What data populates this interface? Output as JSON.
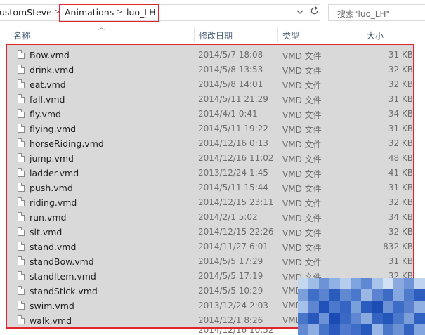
{
  "address": {
    "crumbs": [
      "ustomSteve",
      "Animations",
      "luo_LH"
    ],
    "separator": ">",
    "dropdown_icon": "chevron-down-icon",
    "refresh_icon": "refresh-icon"
  },
  "search": {
    "placeholder": "搜索\"luo_LH\""
  },
  "columns": {
    "name": "名称",
    "date": "修改日期",
    "type": "类型",
    "size": "大小"
  },
  "files": [
    {
      "name": "Bow.vmd",
      "date": "2014/5/7 18:08",
      "type": "VMD 文件",
      "size": "31 KB"
    },
    {
      "name": "drink.vmd",
      "date": "2014/5/8 13:53",
      "type": "VMD 文件",
      "size": "32 KB"
    },
    {
      "name": "eat.vmd",
      "date": "2014/5/8 14:01",
      "type": "VMD 文件",
      "size": "32 KB"
    },
    {
      "name": "fall.vmd",
      "date": "2014/5/11 21:29",
      "type": "VMD 文件",
      "size": "31 KB"
    },
    {
      "name": "fly.vmd",
      "date": "2014/4/1 0:41",
      "type": "VMD 文件",
      "size": "34 KB"
    },
    {
      "name": "flying.vmd",
      "date": "2014/5/11 19:22",
      "type": "VMD 文件",
      "size": "31 KB"
    },
    {
      "name": "horseRiding.vmd",
      "date": "2014/12/16 0:13",
      "type": "VMD 文件",
      "size": "32 KB"
    },
    {
      "name": "jump.vmd",
      "date": "2014/12/16 11:02",
      "type": "VMD 文件",
      "size": "48 KB"
    },
    {
      "name": "ladder.vmd",
      "date": "2013/12/24 1:45",
      "type": "VMD 文件",
      "size": "41 KB"
    },
    {
      "name": "push.vmd",
      "date": "2014/5/11 15:44",
      "type": "VMD 文件",
      "size": "31 KB"
    },
    {
      "name": "riding.vmd",
      "date": "2014/12/15 23:11",
      "type": "VMD 文件",
      "size": "32 KB"
    },
    {
      "name": "run.vmd",
      "date": "2014/2/1 5:02",
      "type": "VMD 文件",
      "size": "34 KB"
    },
    {
      "name": "sit.vmd",
      "date": "2014/12/15 22:26",
      "type": "VMD 文件",
      "size": "32 KB"
    },
    {
      "name": "stand.vmd",
      "date": "2014/11/27 6:01",
      "type": "VMD 文件",
      "size": "832 KB"
    },
    {
      "name": "standBow.vmd",
      "date": "2014/5/5 17:29",
      "type": "VMD 文件",
      "size": "31 KB"
    },
    {
      "name": "standItem.vmd",
      "date": "2014/5/5 17:19",
      "type": "VMD 文件",
      "size": "32 KB"
    },
    {
      "name": "standStick.vmd",
      "date": "2014/5/5 10:29",
      "type": "VMD",
      "size": ""
    },
    {
      "name": "swim.vmd",
      "date": "2013/12/24 2:03",
      "type": "VMD",
      "size": ""
    },
    {
      "name": "walk.vmd",
      "date": "2014/12/1 8:26",
      "type": "VMD",
      "size": ""
    }
  ],
  "partial_row": {
    "name": "",
    "date": "2014/12/16 10:52"
  },
  "colors": {
    "highlight": "#e0262b",
    "selection": "#d9d9d9",
    "header_text": "#4c607a"
  },
  "mosaic_colors": [
    "#c5d8f0",
    "#9fbce6",
    "#6d93d6",
    "#8fb1e3",
    "#b7cdee",
    "#7fa3dc",
    "#5f88d2",
    "#a9c4eb",
    "#d2e0f4",
    "#8ba9df",
    "#6e94d7",
    "#c0d4ef",
    "#7b9fda",
    "#3f6fc7",
    "#5a83d0",
    "#2a5cbe",
    "#6189d2",
    "#4a78cc",
    "#9bb8e5",
    "#5b83cf",
    "#3c6bc6",
    "#85a7e0",
    "#4e7bcc",
    "#2d5dbf",
    "#a5c1ea",
    "#5d85d0",
    "#1f51b8",
    "#4c79cb",
    "#3564c2",
    "#7aa0db",
    "#2b5bbd",
    "#1c4db5",
    "#6a90d5",
    "#3d6cc6",
    "#5880cf",
    "#90b0e3",
    "#4877ca",
    "#2858bc",
    "#6d93d6",
    "#1a4bb4",
    "#3a69c5",
    "#5f87d1",
    "#8aabe0",
    "#3563c2",
    "#2455bb",
    "#4b78cb",
    "#7c9fda",
    "#3060c0",
    "#6389d3",
    "#8eaee2",
    "#4574c9",
    "#2a5abd",
    "#5179cd",
    "#3e6cc6",
    "#2758bc",
    "#98b6e5",
    "#4a77ca",
    "#6c92d5",
    "#3464c2",
    "#82a5df"
  ]
}
